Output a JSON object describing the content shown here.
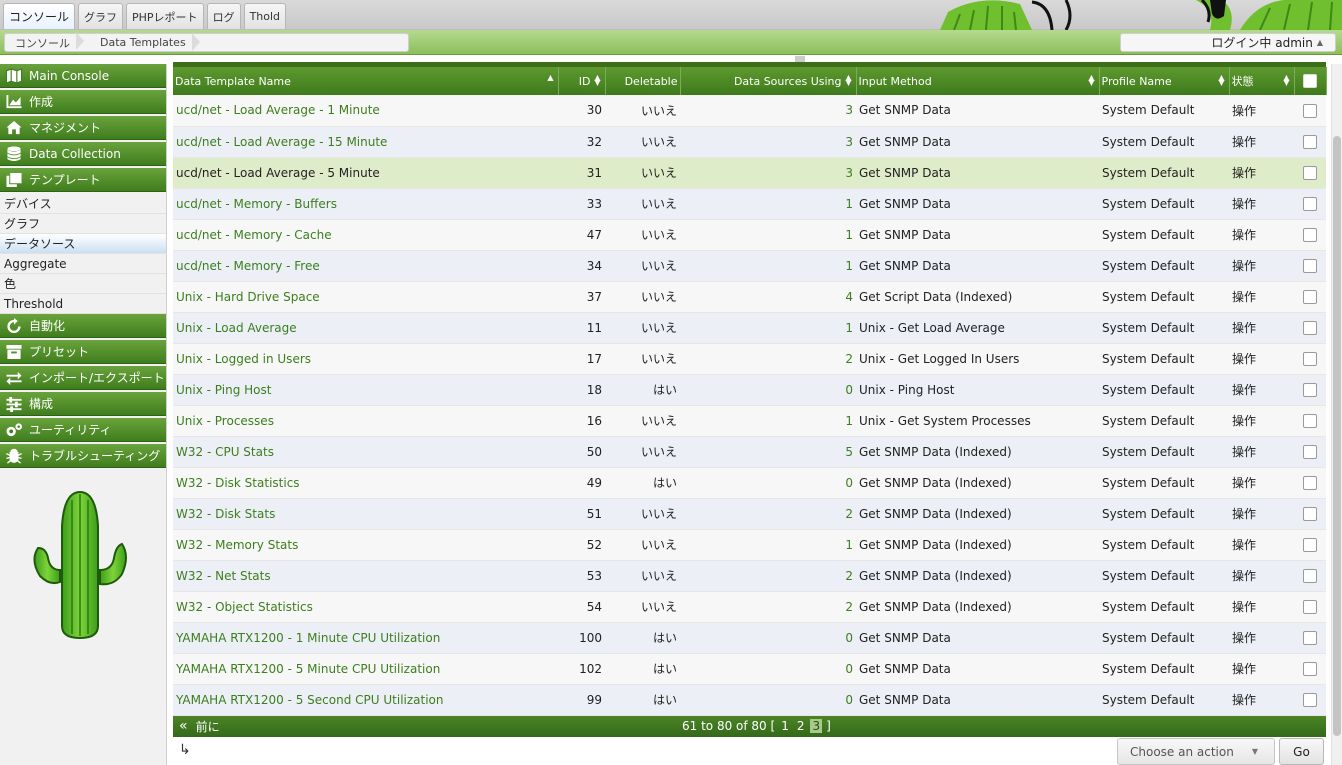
{
  "top_tabs": [
    "コンソール",
    "グラフ",
    "PHPレポート",
    "ログ",
    "Thold"
  ],
  "breadcrumb": [
    "コンソール",
    "Data Templates"
  ],
  "user_menu": {
    "label": "ログイン中 admin",
    "caret": "▲"
  },
  "sidebar": {
    "sections": [
      {
        "label": "Main Console",
        "icon": "map-icon"
      },
      {
        "label": "作成",
        "icon": "chart-icon"
      },
      {
        "label": "マネジメント",
        "icon": "home-icon"
      },
      {
        "label": "Data Collection",
        "icon": "database-icon"
      },
      {
        "label": "テンプレート",
        "icon": "copy-icon"
      }
    ],
    "template_items": [
      "デバイス",
      "グラフ",
      "データソース",
      "Aggregate",
      "色",
      "Threshold"
    ],
    "sections_after": [
      {
        "label": "自動化",
        "icon": "refresh-icon"
      },
      {
        "label": "プリセット",
        "icon": "archive-icon"
      },
      {
        "label": "インポート/エクスポート",
        "icon": "exchange-icon"
      },
      {
        "label": "構成",
        "icon": "sliders-icon"
      },
      {
        "label": "ユーティリティ",
        "icon": "gears-icon"
      },
      {
        "label": "トラブルシューティング",
        "icon": "bug-icon"
      }
    ]
  },
  "table": {
    "columns": [
      "Data Template Name",
      "ID",
      "Deletable",
      "Data Sources Using",
      "Input Method",
      "Profile Name",
      "状態"
    ],
    "rows": [
      {
        "name": "ucd/net - Load Average - 1 Minute",
        "id": "30",
        "deletable": "いいえ",
        "using": "3",
        "method": "Get SNMP Data",
        "profile": "System Default",
        "status": "操作"
      },
      {
        "name": "ucd/net - Load Average - 15 Minute",
        "id": "32",
        "deletable": "いいえ",
        "using": "3",
        "method": "Get SNMP Data",
        "profile": "System Default",
        "status": "操作"
      },
      {
        "name": "ucd/net - Load Average - 5 Minute",
        "id": "31",
        "deletable": "いいえ",
        "using": "3",
        "method": "Get SNMP Data",
        "profile": "System Default",
        "status": "操作"
      },
      {
        "name": "ucd/net - Memory - Buffers",
        "id": "33",
        "deletable": "いいえ",
        "using": "1",
        "method": "Get SNMP Data",
        "profile": "System Default",
        "status": "操作"
      },
      {
        "name": "ucd/net - Memory - Cache",
        "id": "47",
        "deletable": "いいえ",
        "using": "1",
        "method": "Get SNMP Data",
        "profile": "System Default",
        "status": "操作"
      },
      {
        "name": "ucd/net - Memory - Free",
        "id": "34",
        "deletable": "いいえ",
        "using": "1",
        "method": "Get SNMP Data",
        "profile": "System Default",
        "status": "操作"
      },
      {
        "name": "Unix - Hard Drive Space",
        "id": "37",
        "deletable": "いいえ",
        "using": "4",
        "method": "Get Script Data (Indexed)",
        "profile": "System Default",
        "status": "操作"
      },
      {
        "name": "Unix - Load Average",
        "id": "11",
        "deletable": "いいえ",
        "using": "1",
        "method": "Unix - Get Load Average",
        "profile": "System Default",
        "status": "操作"
      },
      {
        "name": "Unix - Logged in Users",
        "id": "17",
        "deletable": "いいえ",
        "using": "2",
        "method": "Unix - Get Logged In Users",
        "profile": "System Default",
        "status": "操作"
      },
      {
        "name": "Unix - Ping Host",
        "id": "18",
        "deletable": "はい",
        "using": "0",
        "method": "Unix - Ping Host",
        "profile": "System Default",
        "status": "操作"
      },
      {
        "name": "Unix - Processes",
        "id": "16",
        "deletable": "いいえ",
        "using": "1",
        "method": "Unix - Get System Processes",
        "profile": "System Default",
        "status": "操作"
      },
      {
        "name": "W32 - CPU Stats",
        "id": "50",
        "deletable": "いいえ",
        "using": "5",
        "method": "Get SNMP Data (Indexed)",
        "profile": "System Default",
        "status": "操作"
      },
      {
        "name": "W32 - Disk Statistics",
        "id": "49",
        "deletable": "はい",
        "using": "0",
        "method": "Get SNMP Data (Indexed)",
        "profile": "System Default",
        "status": "操作"
      },
      {
        "name": "W32 - Disk Stats",
        "id": "51",
        "deletable": "いいえ",
        "using": "2",
        "method": "Get SNMP Data (Indexed)",
        "profile": "System Default",
        "status": "操作"
      },
      {
        "name": "W32 - Memory Stats",
        "id": "52",
        "deletable": "いいえ",
        "using": "1",
        "method": "Get SNMP Data (Indexed)",
        "profile": "System Default",
        "status": "操作"
      },
      {
        "name": "W32 - Net Stats",
        "id": "53",
        "deletable": "いいえ",
        "using": "2",
        "method": "Get SNMP Data (Indexed)",
        "profile": "System Default",
        "status": "操作"
      },
      {
        "name": "W32 - Object Statistics",
        "id": "54",
        "deletable": "いいえ",
        "using": "2",
        "method": "Get SNMP Data (Indexed)",
        "profile": "System Default",
        "status": "操作"
      },
      {
        "name": "YAMAHA RTX1200 - 1 Minute CPU Utilization",
        "id": "100",
        "deletable": "はい",
        "using": "0",
        "method": "Get SNMP Data",
        "profile": "System Default",
        "status": "操作"
      },
      {
        "name": "YAMAHA RTX1200 - 5 Minute CPU Utilization",
        "id": "102",
        "deletable": "はい",
        "using": "0",
        "method": "Get SNMP Data",
        "profile": "System Default",
        "status": "操作"
      },
      {
        "name": "YAMAHA RTX1200 - 5 Second CPU Utilization",
        "id": "99",
        "deletable": "はい",
        "using": "0",
        "method": "Get SNMP Data",
        "profile": "System Default",
        "status": "操作"
      }
    ]
  },
  "pagination": {
    "prev_label": "前に",
    "range_text": "61 to 80 of 80 [",
    "pages": [
      "1",
      "2",
      "3"
    ],
    "current_page": "3",
    "close_bracket": "]"
  },
  "actions": {
    "select_placeholder": "Choose an action",
    "go_label": "Go"
  }
}
